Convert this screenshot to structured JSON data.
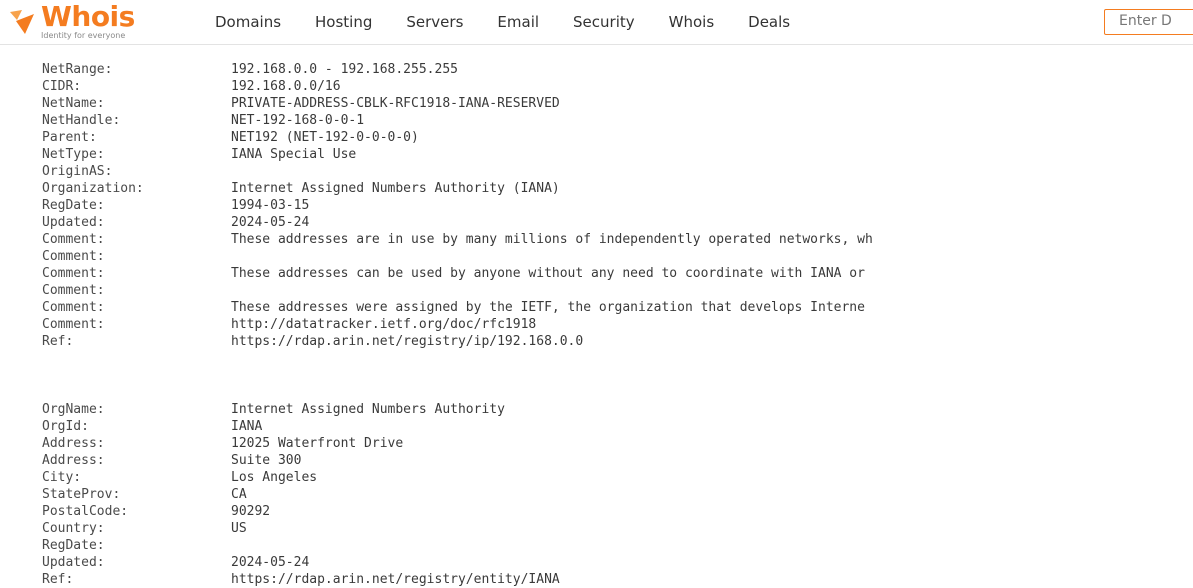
{
  "header": {
    "logo": {
      "name": "Whois",
      "tagline": "Identity for everyone",
      "brand_color": "#f47c20",
      "icon": "whois-logo-icon"
    },
    "nav": [
      "Domains",
      "Hosting",
      "Servers",
      "Email",
      "Security",
      "Whois",
      "Deals"
    ],
    "search_text": "Enter D"
  },
  "network_record": [
    {
      "key": "NetRange:",
      "value": "192.168.0.0 - 192.168.255.255"
    },
    {
      "key": "CIDR:",
      "value": "192.168.0.0/16"
    },
    {
      "key": "NetName:",
      "value": "PRIVATE-ADDRESS-CBLK-RFC1918-IANA-RESERVED"
    },
    {
      "key": "NetHandle:",
      "value": "NET-192-168-0-0-1"
    },
    {
      "key": "Parent:",
      "value": "NET192 (NET-192-0-0-0-0)"
    },
    {
      "key": "NetType:",
      "value": "IANA Special Use"
    },
    {
      "key": "OriginAS:",
      "value": ""
    },
    {
      "key": "Organization:",
      "value": "Internet Assigned Numbers Authority (IANA)"
    },
    {
      "key": "RegDate:",
      "value": "1994-03-15"
    },
    {
      "key": "Updated:",
      "value": "2024-05-24"
    },
    {
      "key": "Comment:",
      "value": "These addresses are in use by many millions of independently operated networks, wh"
    },
    {
      "key": "Comment:",
      "value": ""
    },
    {
      "key": "Comment:",
      "value": "These addresses can be used by anyone without any need to coordinate with IANA or"
    },
    {
      "key": "Comment:",
      "value": ""
    },
    {
      "key": "Comment:",
      "value": "These addresses were assigned by the IETF, the organization that develops Interne"
    },
    {
      "key": "Comment:",
      "value": "http://datatracker.ietf.org/doc/rfc1918"
    },
    {
      "key": "Ref:",
      "value": "https://rdap.arin.net/registry/ip/192.168.0.0"
    }
  ],
  "org_record": [
    {
      "key": "OrgName:",
      "value": "Internet Assigned Numbers Authority"
    },
    {
      "key": "OrgId:",
      "value": "IANA"
    },
    {
      "key": "Address:",
      "value": "12025 Waterfront Drive"
    },
    {
      "key": "Address:",
      "value": "Suite 300"
    },
    {
      "key": "City:",
      "value": "Los Angeles"
    },
    {
      "key": "StateProv:",
      "value": "CA"
    },
    {
      "key": "PostalCode:",
      "value": "90292"
    },
    {
      "key": "Country:",
      "value": "US"
    },
    {
      "key": "RegDate:",
      "value": ""
    },
    {
      "key": "Updated:",
      "value": "2024-05-24"
    },
    {
      "key": "Ref:",
      "value": "https://rdap.arin.net/registry/entity/IANA"
    }
  ]
}
